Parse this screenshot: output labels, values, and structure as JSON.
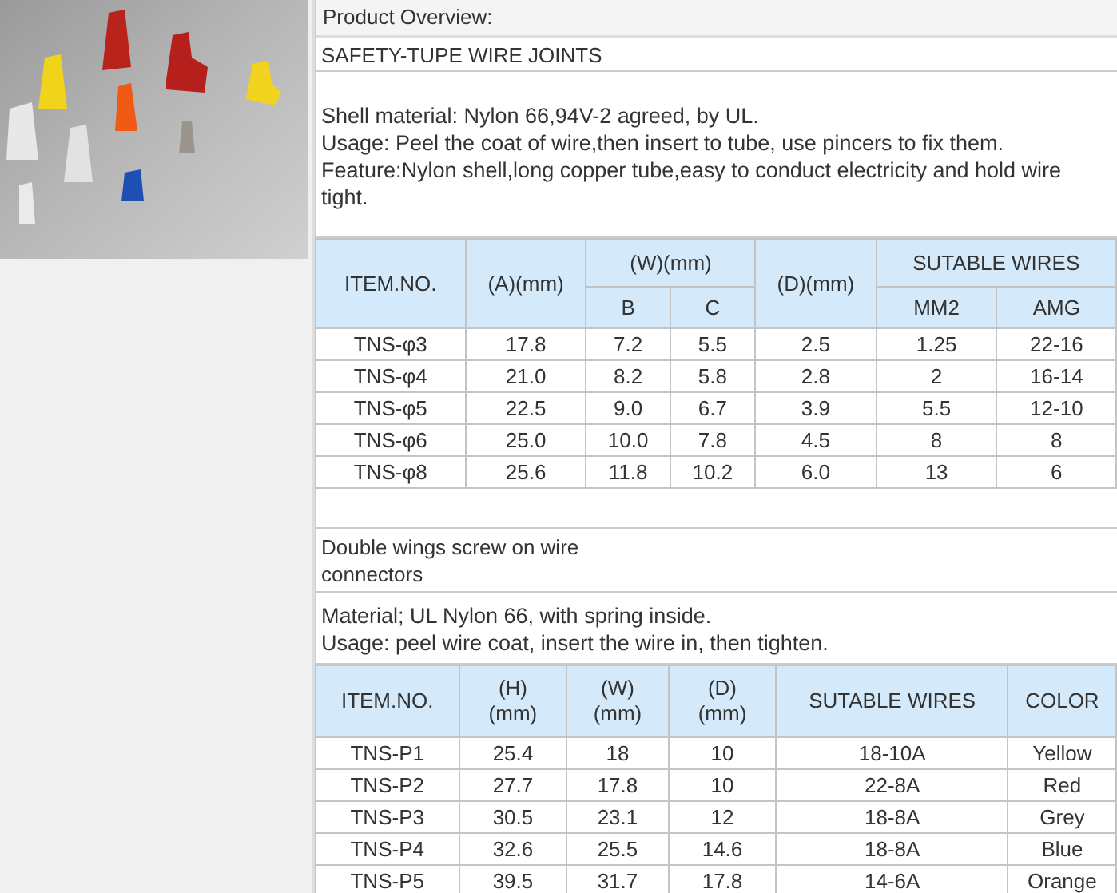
{
  "header": "Product Overview:",
  "sections": [
    {
      "title": "SAFETY-TUPE WIRE JOINTS",
      "description": [
        "Shell material: Nylon 66,94V-2 agreed, by UL.",
        "Usage: Peel the coat of wire,then insert to tube, use pincers to fix them.",
        "Feature:Nylon shell,long copper tube,easy to conduct electricity and hold wire tight."
      ],
      "table": {
        "header_rows": [
          [
            {
              "label": "ITEM.NO.",
              "rowspan": 2
            },
            {
              "label": "(A)(mm)",
              "rowspan": 2
            },
            {
              "label": "(W)(mm)",
              "colspan": 2
            },
            {
              "label": "(D)(mm)",
              "rowspan": 2
            },
            {
              "label": "SUTABLE WIRES",
              "colspan": 2
            }
          ],
          [
            {
              "label": "B"
            },
            {
              "label": "C"
            },
            {
              "label": "MM2"
            },
            {
              "label": "AMG"
            }
          ]
        ],
        "rows": [
          [
            "TNS-φ3",
            "17.8",
            "7.2",
            "5.5",
            "2.5",
            "1.25",
            "22-16"
          ],
          [
            "TNS-φ4",
            "21.0",
            "8.2",
            "5.8",
            "2.8",
            "2",
            "16-14"
          ],
          [
            "TNS-φ5",
            "22.5",
            "9.0",
            "6.7",
            "3.9",
            "5.5",
            "12-10"
          ],
          [
            "TNS-φ6",
            "25.0",
            "10.0",
            "7.8",
            "4.5",
            "8",
            "8"
          ],
          [
            "TNS-φ8",
            "25.6",
            "11.8",
            "10.2",
            "6.0",
            "13",
            "6"
          ]
        ]
      }
    },
    {
      "title": "Double wings screw on wire\nconnectors",
      "description": [
        "Material; UL Nylon 66, with spring inside.",
        "Usage: peel wire coat, insert the wire in, then tighten."
      ],
      "table": {
        "header_rows": [
          [
            {
              "label": "ITEM.NO."
            },
            {
              "label": "(H)\n(mm)"
            },
            {
              "label": "(W)\n(mm)"
            },
            {
              "label": "(D)\n(mm)"
            },
            {
              "label": "SUTABLE WIRES"
            },
            {
              "label": "COLOR"
            }
          ]
        ],
        "rows": [
          [
            "TNS-P1",
            "25.4",
            "18",
            "10",
            "18-10A",
            "Yellow"
          ],
          [
            "TNS-P2",
            "27.7",
            "17.8",
            "10",
            "22-8A",
            "Red"
          ],
          [
            "TNS-P3",
            "30.5",
            "23.1",
            "12",
            "18-8A",
            "Grey"
          ],
          [
            "TNS-P4",
            "32.6",
            "25.5",
            "14.6",
            "18-8A",
            "Blue"
          ],
          [
            "TNS-P5",
            "39.5",
            "31.7",
            "17.8",
            "14-6A",
            "Orange"
          ]
        ]
      }
    }
  ]
}
